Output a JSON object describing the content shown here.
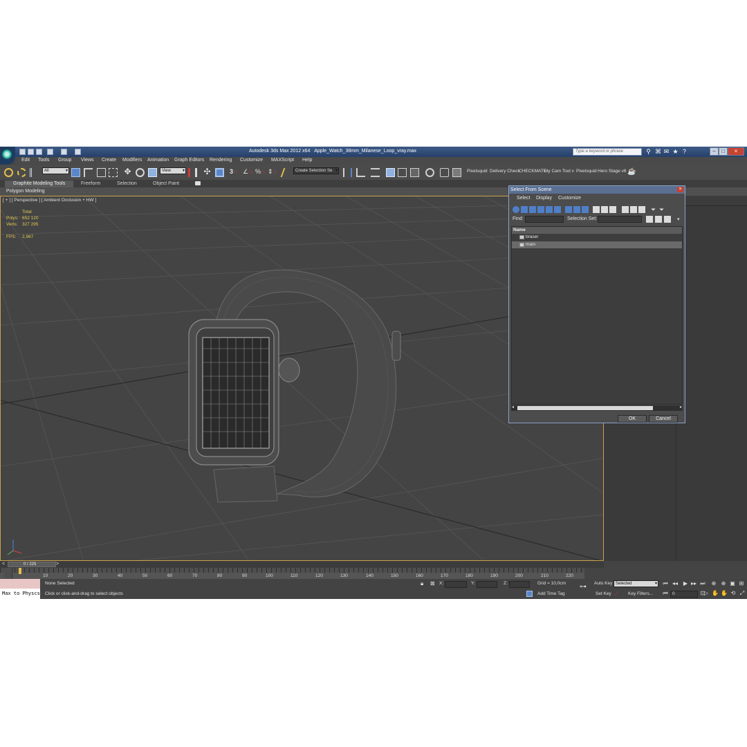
{
  "title_bar": {
    "app_title": "Autodesk 3ds Max  2012 x64",
    "file_name": "Apple_Watch_38mm_Milanese_Loop_vray.max",
    "search_placeholder": "Type a keyword or phrase"
  },
  "menu": [
    "Edit",
    "Tools",
    "Group",
    "Views",
    "Create",
    "Modifiers",
    "Animation",
    "Graph Editors",
    "Rendering",
    "Customize",
    "MAXScript",
    "Help"
  ],
  "toolbar": {
    "selection_filter": "All",
    "reference_coord": "View",
    "named_selection_set": "Create Selection Se",
    "plugins": [
      "Pixelsquid",
      "Delivery Check",
      "CHECKMATE",
      "uty Cam Tool v",
      "Pixelsquid",
      "Hero Stage v6"
    ]
  },
  "ribbon": {
    "tabs": [
      "Graphite Modeling Tools",
      "Freeform",
      "Selection",
      "Object Paint"
    ],
    "sub_label": "Polygon Modeling"
  },
  "viewport": {
    "label": "[ + ] [ Perspective ] [ Ambient Occlusion + HW ]",
    "stats": {
      "header": "Total",
      "polys_label": "Polys:",
      "polys_value": "652 120",
      "verts_label": "Verts:",
      "verts_value": "327 295",
      "fps_label": "FPS:",
      "fps_value": "2,987"
    }
  },
  "timeline": {
    "frame_indicator": "0 / 225",
    "ticks": [
      "10",
      "20",
      "30",
      "40",
      "50",
      "60",
      "70",
      "80",
      "90",
      "100",
      "110",
      "120",
      "130",
      "140",
      "150",
      "160",
      "170",
      "180",
      "190",
      "200",
      "210",
      "220"
    ]
  },
  "status": {
    "listener_text": "Max to Physcs",
    "selection_status": "None Selected",
    "prompt": "Click or click-and-drag to select objects",
    "x_label": "X:",
    "y_label": "Y:",
    "z_label": "Z:",
    "grid": "Grid = 10,0cm",
    "add_time_tag": "Add Time Tag",
    "auto_key": "Auto Key",
    "selected_option": "Selected",
    "set_key": "Set Key",
    "key_filters": "Key Filters...",
    "current_frame": "0"
  },
  "dialog": {
    "title": "Select From Scene",
    "close": "×",
    "menus": [
      "Select",
      "Display",
      "Customize"
    ],
    "find_label": "Find:",
    "selection_set_label": "Selection Set:",
    "column_name": "Name",
    "rows": [
      "braser",
      "main"
    ],
    "ok": "OK",
    "cancel": "Cancel"
  }
}
